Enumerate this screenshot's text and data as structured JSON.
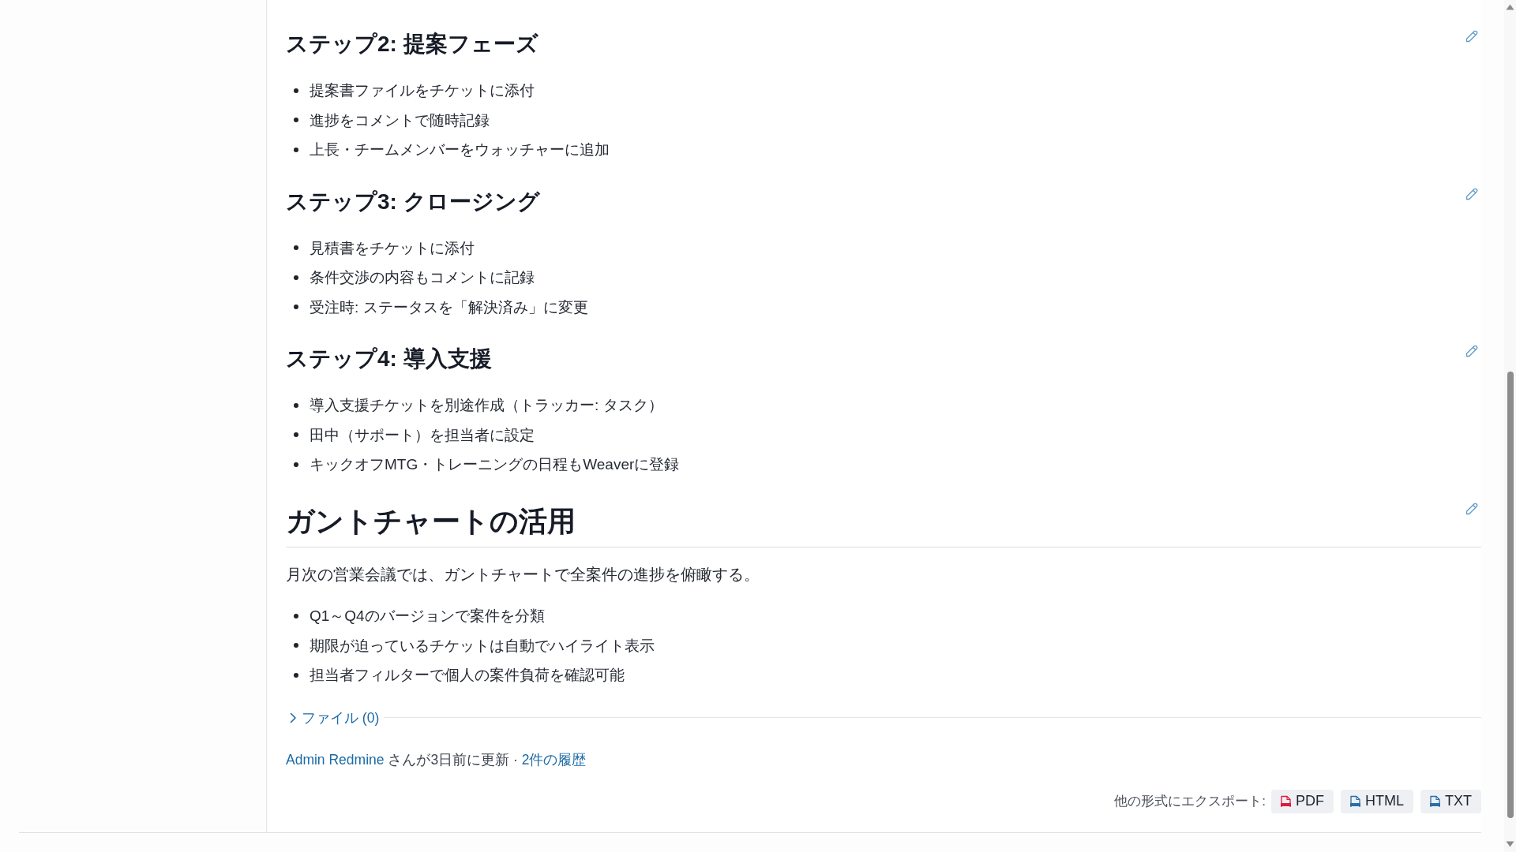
{
  "sections": [
    {
      "kind": "subheading",
      "heading": "ステップ2: 提案フェーズ",
      "items": [
        "提案書ファイルをチケットに添付",
        "進捗をコメントで随時記録",
        "上長・チームメンバーをウォッチャーに追加"
      ]
    },
    {
      "kind": "subheading",
      "heading": "ステップ3: クロージング",
      "items": [
        "見積書をチケットに添付",
        "条件交渉の内容もコメントに記録",
        "受注時: ステータスを「解決済み」に変更"
      ]
    },
    {
      "kind": "subheading",
      "heading": "ステップ4: 導入支援",
      "items": [
        "導入支援チケットを別途作成（トラッカー: タスク）",
        "田中（サポート）を担当者に設定",
        "キックオフMTG・トレーニングの日程もWeaverに登録"
      ]
    },
    {
      "kind": "heading",
      "heading": "ガントチャートの活用",
      "paragraph": "月次の営業会議では、ガントチャートで全案件の進捗を俯瞰する。",
      "items": [
        "Q1～Q4のバージョンで案件を分類",
        "期限が迫っているチケットは自動でハイライト表示",
        "担当者フィルターで個人の案件負荷を確認可能"
      ]
    }
  ],
  "attachments": {
    "label": "ファイル (0)",
    "expanded": false
  },
  "history": {
    "author": "Admin Redmine",
    "text": "さんが3日前に更新 ·",
    "link": "2件の履歴"
  },
  "export": {
    "label": "他の形式にエクスポート:",
    "formats": [
      {
        "kind": "pdf",
        "label": "PDF"
      },
      {
        "kind": "html",
        "label": "HTML"
      },
      {
        "kind": "txt",
        "label": "TXT"
      }
    ]
  }
}
